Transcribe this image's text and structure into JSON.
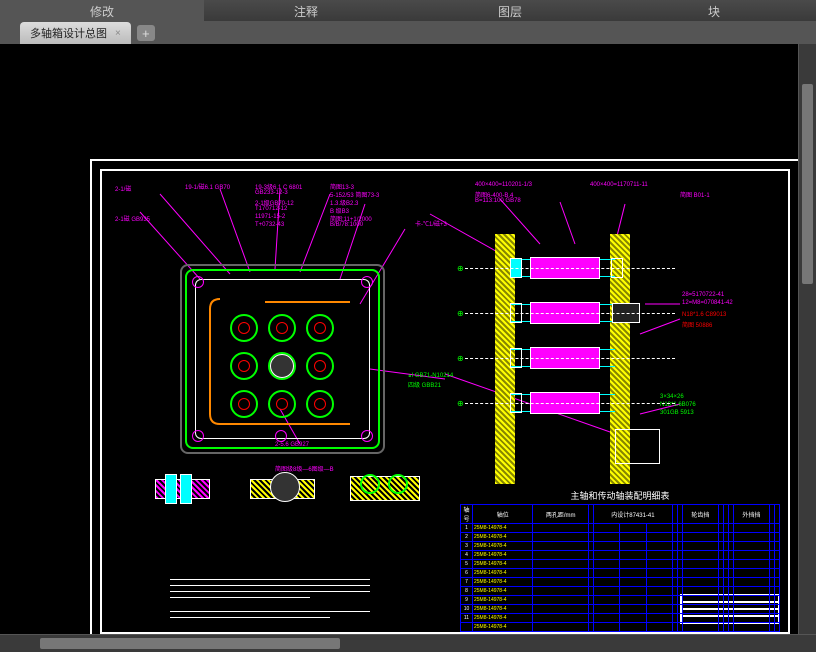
{
  "menubar": {
    "items": [
      "修改",
      "注释",
      "图层",
      "块"
    ]
  },
  "tab": {
    "name": "多轴箱设计总图",
    "close": "×"
  },
  "newtab": "+",
  "drawing": {
    "annotations_left": [
      "2-1/磁",
      "2-1磁 GB935",
      "19-1/磁6.1 GB70",
      "19-3级6.1 C 6801",
      "GB233-12-3",
      "2-1级GB70-12",
      "T170712-12",
      "11971-15-2",
      "T+0732-43"
    ],
    "annotations_top": [
      "简图13-3",
      "5-152/53 简图73-3",
      "1.3.级B2.3",
      "B 级B3",
      "简图:11+1/2000",
      "B/B/78:1000"
    ],
    "annotations_mid": [
      "卡-℃1/磁+3"
    ],
    "annotations_right_top": [
      "400×400=110201-1/3",
      "简图6-400-B.4",
      "B=113:100 GB78",
      "400×400=1170711-11",
      "简图 B01-1"
    ],
    "annotations_right": [
      "28=5170722-41",
      "12=M8=070841-42",
      "N18*1.6 C89013",
      "简图 50886"
    ],
    "annotations_bottom_right": [
      "3×34×26",
      "N18*1.6B076",
      "301GB 5913"
    ],
    "annotation_green1": "اہ GB71-N10214",
    "annotation_green2": "四级 GBB21",
    "annotation_bottom": "2-5.6 GB927",
    "detail_label": "简图级8级—6图级—B"
  },
  "table": {
    "title": "主轴和传动轴装配明细表",
    "headers": [
      "轴号",
      "轴位",
      "两孔距/mm",
      "",
      "内设计87431-41",
      "",
      "",
      "",
      "",
      "轮齿挡",
      "",
      "",
      "",
      "外挡挡",
      "",
      ""
    ],
    "rows": [
      {
        "n": "1",
        "p": "25M8-14978-4"
      },
      {
        "n": "2",
        "p": "25M8-14978-4"
      },
      {
        "n": "3",
        "p": "25M8-14978-4"
      },
      {
        "n": "4",
        "p": "25M8-14978-4"
      },
      {
        "n": "5",
        "p": "25M8-14978-4"
      },
      {
        "n": "6",
        "p": "25M8-14978-4"
      },
      {
        "n": "7",
        "p": "25M8-14978-4"
      },
      {
        "n": "8",
        "p": "25M8-14978-4"
      },
      {
        "n": "9",
        "p": "25M8-14978-4"
      },
      {
        "n": "10",
        "p": "25M8-14978-4"
      },
      {
        "n": "11",
        "p": "25M8-14978-4"
      },
      {
        "n": "",
        "p": "25M8-14978-4"
      }
    ]
  },
  "notes": "注：需检查装配各段度和位置精度后整体机加工定位孔及工艺孔。"
}
